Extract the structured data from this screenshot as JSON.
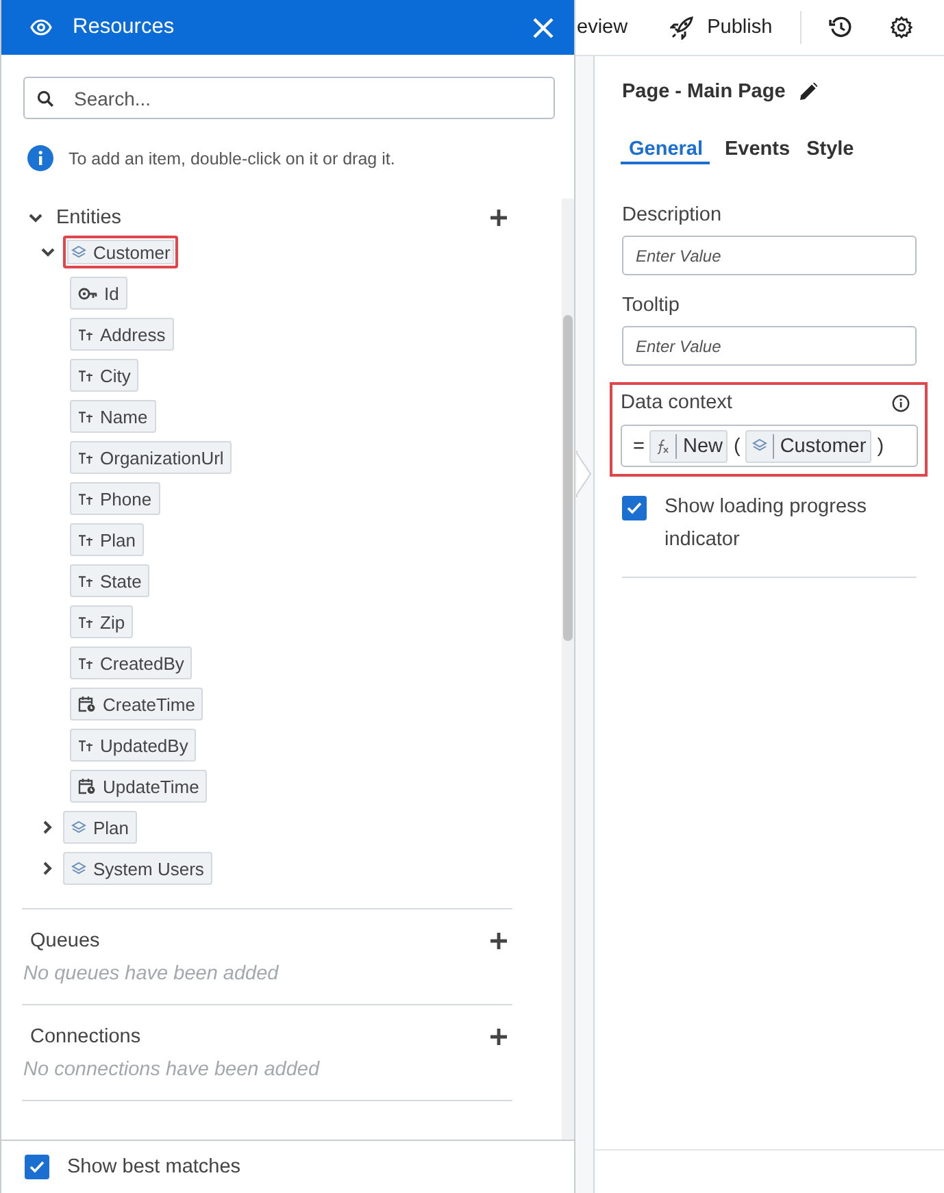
{
  "top_bar": {
    "items": [
      {
        "kind": "text",
        "label": "eview"
      },
      {
        "kind": "publish",
        "label": "Publish"
      },
      {
        "kind": "history"
      },
      {
        "kind": "settings"
      }
    ]
  },
  "resources": {
    "title": "Resources",
    "search": {
      "placeholder": "Search..."
    },
    "hint": "To add an item, double-click on it or drag it.",
    "sections": [
      {
        "kind": "tree",
        "title": "Entities",
        "expanded": true,
        "items": [
          {
            "kind": "entity",
            "label": "Customer",
            "expanded": true,
            "highlighted": true,
            "children": [
              {
                "kind": "key",
                "label": "Id",
                "highlighted": false
              },
              {
                "kind": "text",
                "label": "Address",
                "highlighted": false
              },
              {
                "kind": "text",
                "label": "City",
                "highlighted": false
              },
              {
                "kind": "text",
                "label": "Name",
                "highlighted": false
              },
              {
                "kind": "text",
                "label": "OrganizationUrl",
                "highlighted": false
              },
              {
                "kind": "text",
                "label": "Phone",
                "highlighted": false
              },
              {
                "kind": "text",
                "label": "Plan",
                "highlighted": false
              },
              {
                "kind": "text",
                "label": "State",
                "highlighted": false
              },
              {
                "kind": "text",
                "label": "Zip",
                "highlighted": false
              },
              {
                "kind": "text",
                "label": "CreatedBy",
                "highlighted": false
              },
              {
                "kind": "datetime",
                "label": "CreateTime",
                "highlighted": false
              },
              {
                "kind": "text",
                "label": "UpdatedBy",
                "highlighted": false
              },
              {
                "kind": "datetime",
                "label": "UpdateTime",
                "highlighted": false
              }
            ]
          },
          {
            "kind": "entity",
            "label": "Plan",
            "expanded": false,
            "highlighted": false
          },
          {
            "kind": "entity",
            "label": "System Users",
            "expanded": false,
            "highlighted": false
          }
        ]
      },
      {
        "kind": "empty",
        "title": "Queues",
        "empty_text": "No queues have been added"
      },
      {
        "kind": "empty",
        "title": "Connections",
        "empty_text": "No connections have been added"
      }
    ],
    "show_best_matches": {
      "label": "Show best matches",
      "checked": true
    }
  },
  "properties": {
    "title": "Page - Main Page",
    "tabs": [
      {
        "label": "General",
        "selected": true
      },
      {
        "label": "Events",
        "selected": false
      },
      {
        "label": "Style",
        "selected": false
      }
    ],
    "fields": [
      {
        "kind": "input",
        "label": "Description",
        "placeholder": "Enter Value",
        "highlighted": false,
        "info": false
      },
      {
        "kind": "input",
        "label": "Tooltip",
        "placeholder": "Enter Value",
        "highlighted": false,
        "info": false
      },
      {
        "kind": "expression",
        "label": "Data context",
        "highlighted": true,
        "info": true,
        "tokens": [
          {
            "kind": "operator",
            "text": "="
          },
          {
            "kind": "function",
            "text": "New"
          },
          {
            "kind": "operator",
            "text": "("
          },
          {
            "kind": "entity",
            "text": "Customer"
          },
          {
            "kind": "operator",
            "text": ")"
          }
        ]
      }
    ],
    "loading_indicator": {
      "label": "Show loading progress indicator",
      "checked": true
    }
  }
}
